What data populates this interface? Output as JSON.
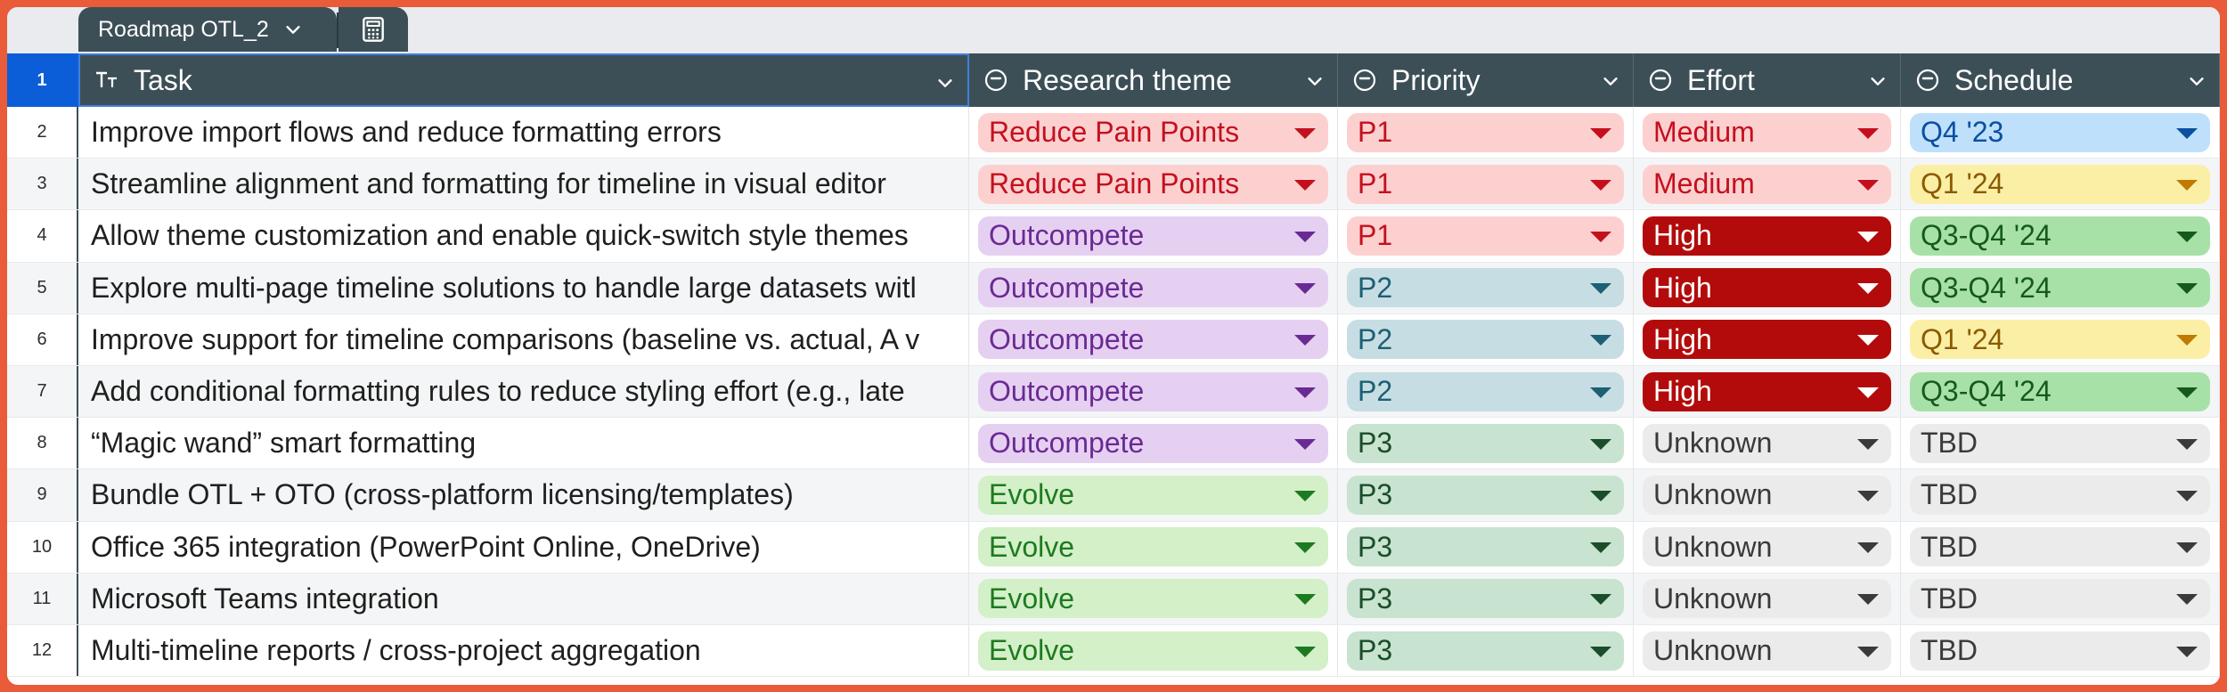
{
  "sheet": {
    "tab_label": "Roadmap OTL_2"
  },
  "columns": [
    {
      "label": "Task",
      "icon": "text-type-icon"
    },
    {
      "label": "Research theme",
      "icon": "dropdown-field-icon"
    },
    {
      "label": "Priority",
      "icon": "dropdown-field-icon"
    },
    {
      "label": "Effort",
      "icon": "dropdown-field-icon"
    },
    {
      "label": "Schedule",
      "icon": "dropdown-field-icon"
    }
  ],
  "header_row_number": "1",
  "colors": {
    "reduce_pain_points": {
      "bg": "#fdd0d0",
      "fg": "#c4101d",
      "arrow": "#c4101d"
    },
    "outcompete": {
      "bg": "#e5d0f2",
      "fg": "#6a2a93",
      "arrow": "#6a2a93"
    },
    "evolve": {
      "bg": "#d3f0c8",
      "fg": "#1e7a20",
      "arrow": "#1e7a20"
    },
    "p1": {
      "bg": "#fdd0d0",
      "fg": "#c4101d",
      "arrow": "#c4101d"
    },
    "p2": {
      "bg": "#c7dde4",
      "fg": "#1d5f73",
      "arrow": "#1d5f73"
    },
    "p3": {
      "bg": "#c8e3cf",
      "fg": "#1a4d2a",
      "arrow": "#1a4d2a"
    },
    "medium": {
      "bg": "#fdd0d0",
      "fg": "#c4101d",
      "arrow": "#c4101d"
    },
    "high": {
      "bg": "#b30b0b",
      "fg": "#ffffff",
      "arrow": "#ffffff"
    },
    "unknown": {
      "bg": "#ebebeb",
      "fg": "#3a3a3a",
      "arrow": "#3a3a3a"
    },
    "q4_23": {
      "bg": "#bfe0fb",
      "fg": "#0b4fa0",
      "arrow": "#0b4fa0"
    },
    "q1_24": {
      "bg": "#fbefa6",
      "fg": "#8a5a00",
      "arrow": "#c07a00"
    },
    "q3q4_24": {
      "bg": "#a7e1a8",
      "fg": "#155a1c",
      "arrow": "#155a1c"
    },
    "tbd": {
      "bg": "#ebebeb",
      "fg": "#3a3a3a",
      "arrow": "#3a3a3a"
    }
  },
  "rows": [
    {
      "num": "2",
      "task": "Improve import flows and reduce formatting errors",
      "theme": "Reduce Pain Points",
      "theme_c": "reduce_pain_points",
      "priority": "P1",
      "priority_c": "p1",
      "effort": "Medium",
      "effort_c": "medium",
      "schedule": "Q4 '23",
      "schedule_c": "q4_23"
    },
    {
      "num": "3",
      "task": "Streamline alignment and formatting for timeline in visual editor",
      "theme": "Reduce Pain Points",
      "theme_c": "reduce_pain_points",
      "priority": "P1",
      "priority_c": "p1",
      "effort": "Medium",
      "effort_c": "medium",
      "schedule": "Q1 '24",
      "schedule_c": "q1_24"
    },
    {
      "num": "4",
      "task": "Allow theme customization and enable quick-switch style themes",
      "theme": "Outcompete",
      "theme_c": "outcompete",
      "priority": "P1",
      "priority_c": "p1",
      "effort": "High",
      "effort_c": "high",
      "schedule": "Q3-Q4 '24",
      "schedule_c": "q3q4_24"
    },
    {
      "num": "5",
      "task": "Explore multi-page timeline solutions to handle large datasets witl",
      "theme": "Outcompete",
      "theme_c": "outcompete",
      "priority": "P2",
      "priority_c": "p2",
      "effort": "High",
      "effort_c": "high",
      "schedule": "Q3-Q4 '24",
      "schedule_c": "q3q4_24"
    },
    {
      "num": "6",
      "task": "Improve support for timeline comparisons (baseline vs. actual, A v",
      "theme": "Outcompete",
      "theme_c": "outcompete",
      "priority": "P2",
      "priority_c": "p2",
      "effort": "High",
      "effort_c": "high",
      "schedule": "Q1 '24",
      "schedule_c": "q1_24"
    },
    {
      "num": "7",
      "task": "Add conditional formatting rules to reduce styling effort (e.g., late",
      "theme": "Outcompete",
      "theme_c": "outcompete",
      "priority": "P2",
      "priority_c": "p2",
      "effort": "High",
      "effort_c": "high",
      "schedule": "Q3-Q4 '24",
      "schedule_c": "q3q4_24"
    },
    {
      "num": "8",
      "task": "“Magic wand” smart formatting",
      "theme": "Outcompete",
      "theme_c": "outcompete",
      "priority": "P3",
      "priority_c": "p3",
      "effort": "Unknown",
      "effort_c": "unknown",
      "schedule": "TBD",
      "schedule_c": "tbd"
    },
    {
      "num": "9",
      "task": "Bundle OTL + OTO (cross-platform licensing/templates)",
      "theme": "Evolve",
      "theme_c": "evolve",
      "priority": "P3",
      "priority_c": "p3",
      "effort": "Unknown",
      "effort_c": "unknown",
      "schedule": "TBD",
      "schedule_c": "tbd"
    },
    {
      "num": "10",
      "task": "Office 365 integration (PowerPoint Online, OneDrive)",
      "theme": "Evolve",
      "theme_c": "evolve",
      "priority": "P3",
      "priority_c": "p3",
      "effort": "Unknown",
      "effort_c": "unknown",
      "schedule": "TBD",
      "schedule_c": "tbd"
    },
    {
      "num": "11",
      "task": "Microsoft Teams integration",
      "theme": "Evolve",
      "theme_c": "evolve",
      "priority": "P3",
      "priority_c": "p3",
      "effort": "Unknown",
      "effort_c": "unknown",
      "schedule": "TBD",
      "schedule_c": "tbd"
    },
    {
      "num": "12",
      "task": "Multi-timeline reports / cross-project aggregation",
      "theme": "Evolve",
      "theme_c": "evolve",
      "priority": "P3",
      "priority_c": "p3",
      "effort": "Unknown",
      "effort_c": "unknown",
      "schedule": "TBD",
      "schedule_c": "tbd"
    }
  ]
}
